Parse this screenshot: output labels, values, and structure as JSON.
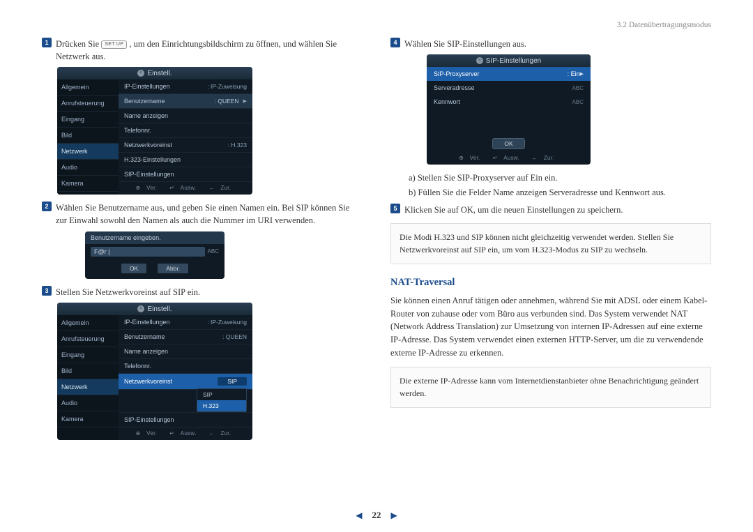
{
  "header": {
    "section": "3.2 Datenübertragungsmodus"
  },
  "keys": {
    "setup": "SET UP"
  },
  "steps": {
    "s1a": "Drücken Sie ",
    "s1b": ", um den Einrichtungsbildschirm zu öffnen, und wählen Sie Netzwerk aus.",
    "s2": "Wählen Sie Benutzername aus, und geben Sie einen Namen ein. Bei SIP können Sie zur Einwahl sowohl den Namen als auch die Nummer im URI verwenden.",
    "s3": "Stellen Sie Netzwerkvoreinst auf SIP ein.",
    "s4": "Wählen Sie SIP-Einstellungen aus.",
    "s5": "Klicken Sie auf OK, um die neuen Einstellungen zu speichern."
  },
  "sub4": {
    "a": "a)  Stellen Sie SIP-Proxyserver auf Ein ein.",
    "b": "b)  Füllen Sie die Felder Name anzeigen Serveradresse und Kennwort aus."
  },
  "note1": "Die Modi H.323 und SIP können nicht gleichzeitig verwendet werden. Stellen Sie Netzwerkvoreinst auf SIP ein, um vom H.323-Modus zu SIP zu wechseln.",
  "nat": {
    "title": "NAT-Traversal",
    "para": "Sie können einen Anruf tätigen oder annehmen, während Sie mit ADSL oder einem Kabel-Router von zuhause oder vom Büro aus verbunden sind. Das System verwendet NAT (Network Address Translation) zur Umsetzung von internen IP-Adressen auf eine externe IP-Adresse. Das System verwendet einen externen HTTP-Server, um die zu verwendende externe IP-Adresse zu erkennen.",
    "note": "Die externe IP-Adresse kann vom Internetdienstanbieter ohne Benachrichtigung geändert werden."
  },
  "ui": {
    "title": "Einstell.",
    "side": [
      "Allgemein",
      "Anrufsteuerung",
      "Eingang",
      "Bild",
      "Netzwerk",
      "Audio",
      "Kamera"
    ],
    "rows1": [
      {
        "lab": "IP-Einstellungen",
        "val": ": IP-Zuweisung"
      },
      {
        "lab": "Benutzername",
        "val": ": QUEEN"
      },
      {
        "lab": "Name anzeigen",
        "val": ""
      },
      {
        "lab": "Telefonnr.",
        "val": ""
      },
      {
        "lab": "Netzwerkvoreinst",
        "val": ": H.323"
      },
      {
        "lab": "H.323-Einstellungen",
        "val": ""
      },
      {
        "lab": "SIP-Einstellungen",
        "val": ""
      }
    ],
    "foot": {
      "a": "Ver.",
      "b": "Ausw.",
      "c": "Zur."
    },
    "dlg": {
      "title": "Benutzername eingeben.",
      "value": "F@r |",
      "hint": "ABC",
      "ok": "OK",
      "cancel": "Abbr."
    },
    "dropdown": {
      "sip": "SIP",
      "h323": "H.323"
    },
    "sip": {
      "title": "SIP-Einstellungen",
      "proxy": "SIP-Proxyserver",
      "on": ": Ein",
      "server": "Serveradresse",
      "pass": "Kennwort",
      "hint": "ABC",
      "ok": "OK"
    }
  },
  "pager": {
    "num": "22"
  }
}
